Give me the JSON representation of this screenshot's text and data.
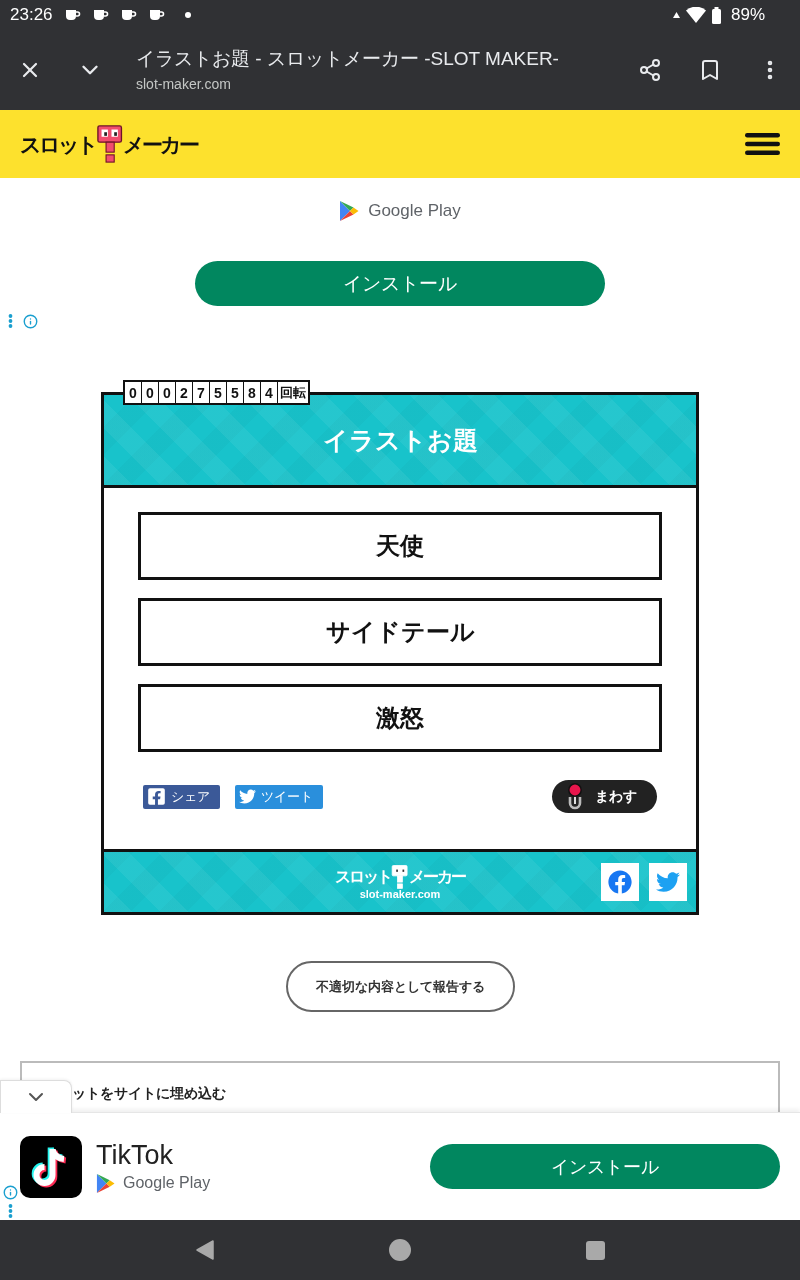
{
  "status_bar": {
    "time": "23:26",
    "battery": "89%"
  },
  "browser_bar": {
    "title": "イラストお題 - スロットメーカー -SLOT MAKER-",
    "url": "slot-maker.com"
  },
  "site_header": {
    "logo": [
      "スロット",
      "メーカー"
    ]
  },
  "top_ad": {
    "store": "Google Play",
    "button": "インストール"
  },
  "slot": {
    "counter": {
      "digits": [
        "0",
        "0",
        "0",
        "2",
        "7",
        "5",
        "5",
        "8",
        "4"
      ],
      "unit": "回転"
    },
    "title": "イラストお題",
    "results": [
      "天使",
      "サイドテール",
      "激怒"
    ],
    "share_buttons": [
      {
        "kind": "facebook",
        "label": "シェア"
      },
      {
        "kind": "twitter",
        "label": "ツイート"
      }
    ],
    "spin_button": "まわす",
    "footer": {
      "logo": [
        "スロット",
        "メーカー"
      ],
      "domain": "slot-maker.com",
      "social": [
        {
          "kind": "facebook"
        },
        {
          "kind": "twitter"
        }
      ]
    }
  },
  "report_button": "不適切な内容として報告する",
  "embed": {
    "label": "ットをサイトに埋め込む"
  },
  "bottom_ad": {
    "app_name": "TikTok",
    "store": "Google Play",
    "button": "インストール"
  }
}
